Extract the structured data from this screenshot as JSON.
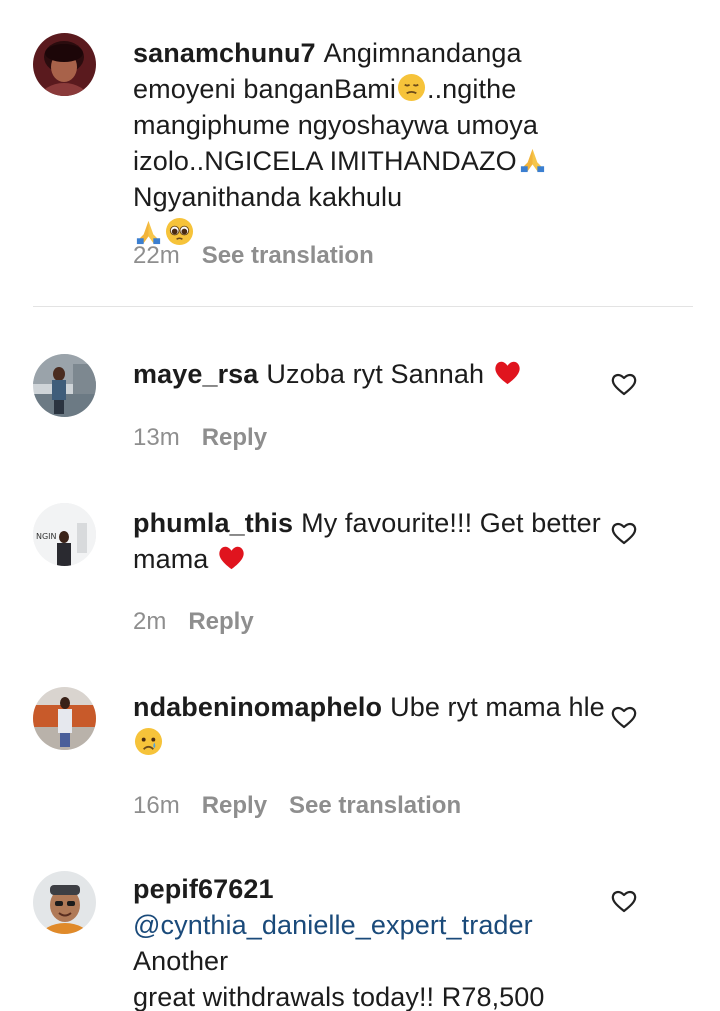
{
  "comments": [
    {
      "username": "sanamchunu7",
      "text_parts": [
        "Angimnandanga emoyeni banganBami",
        "..ngithe mangiphume ngyoshaywa umoya izolo..NGICELA IMITHANDAZO",
        "Ngyanithanda kakhulu"
      ],
      "time": "22m",
      "see_translation": "See translation",
      "emojis": [
        "pensive-face",
        "folded-hands",
        "folded-hands",
        "pleading-face"
      ]
    },
    {
      "username": "maye_rsa",
      "text": "Uzoba ryt Sannah",
      "time": "13m",
      "reply": "Reply",
      "emojis": [
        "red-heart"
      ]
    },
    {
      "username": "phumla_this",
      "text": "My favourite!!! Get better mama",
      "time": "2m",
      "reply": "Reply",
      "emojis": [
        "red-heart"
      ]
    },
    {
      "username": "ndabeninomaphelo",
      "text": "Ube ryt mama hle",
      "time": "16m",
      "reply": "Reply",
      "see_translation": "See translation",
      "emojis": [
        "crying-face"
      ]
    },
    {
      "username": "pepif67621",
      "mention": "@cynthia_danielle_expert_trader",
      "text_line1": "Another",
      "text_line2": "great withdrawals today!! R78,500"
    }
  ],
  "colors": {
    "meta": "#8e8e8e",
    "mention": "#1a4a7a",
    "heart": "#e0141e",
    "divider": "#e3e3e3"
  }
}
